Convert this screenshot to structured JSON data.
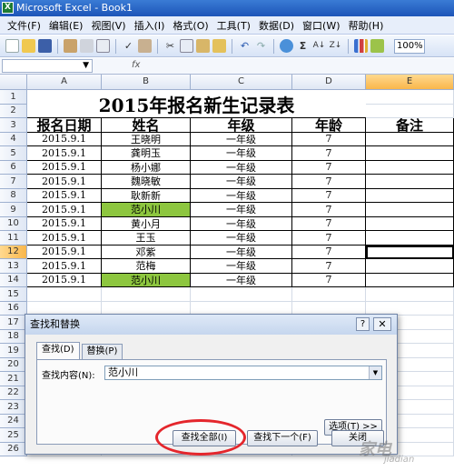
{
  "window": {
    "title": "Microsoft Excel - Book1"
  },
  "menu": [
    "文件(F)",
    "编辑(E)",
    "视图(V)",
    "插入(I)",
    "格式(O)",
    "工具(T)",
    "数据(D)",
    "窗口(W)",
    "帮助(H)"
  ],
  "toolbar": {
    "zoom": "100%",
    "sigma": "Σ"
  },
  "formula_bar": {
    "fx": "fx"
  },
  "columns": [
    "A",
    "B",
    "C",
    "D",
    "E"
  ],
  "rows": [
    "1",
    "2",
    "3",
    "4",
    "5",
    "6",
    "7",
    "8",
    "9",
    "10",
    "11",
    "12",
    "13",
    "14",
    "15",
    "16",
    "17",
    "18",
    "19",
    "20",
    "21",
    "22",
    "23",
    "24",
    "25",
    "26"
  ],
  "sheet": {
    "title": "2015年报名新生记录表",
    "headers": [
      "报名日期",
      "姓名",
      "年级",
      "年龄",
      "备注"
    ],
    "records": [
      [
        "2015.9.1",
        "王晓明",
        "一年级",
        "7"
      ],
      [
        "2015.9.1",
        "龚明玉",
        "一年级",
        "7"
      ],
      [
        "2015.9.1",
        "杨小娜",
        "一年级",
        "7"
      ],
      [
        "2015.9.1",
        "魏晓敏",
        "一年级",
        "7"
      ],
      [
        "2015.9.1",
        "耿新新",
        "一年级",
        "7"
      ],
      [
        "2015.9.1",
        "范小川",
        "一年级",
        "7"
      ],
      [
        "2015.9.1",
        "黄小月",
        "一年级",
        "7"
      ],
      [
        "2015.9.1",
        "王玉",
        "一年级",
        "7"
      ],
      [
        "2015.9.1",
        "邓紫",
        "一年级",
        "7"
      ],
      [
        "2015.9.1",
        "范梅",
        "一年级",
        "7"
      ],
      [
        "2015.9.1",
        "范小川",
        "一年级",
        "7"
      ]
    ],
    "highlight_color": "#8dc63f"
  },
  "dialog": {
    "title": "查找和替换",
    "help": "?",
    "close": "✕",
    "tab_find": "查找(D)",
    "tab_replace": "替换(P)",
    "find_label": "查找内容(N):",
    "find_value": "范小川",
    "options_button": "选项(T) >>",
    "find_all_button": "查找全部(I)",
    "find_next_button": "查找下一个(F)",
    "close_button": "关闭"
  },
  "accent_colors": {
    "title_bar": "#1d55b8",
    "annotation_circle": "#e4262c"
  }
}
